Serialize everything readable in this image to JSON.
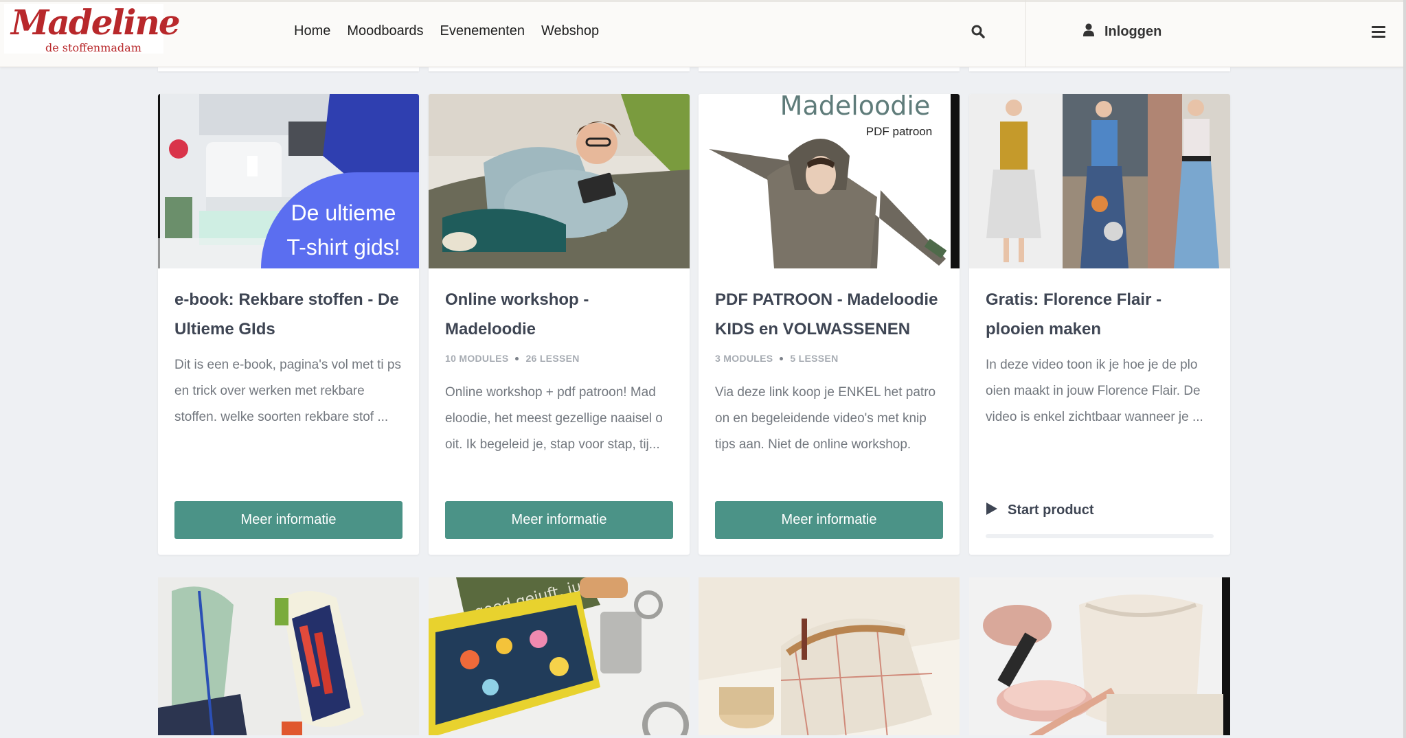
{
  "logo": {
    "main": "Madeline",
    "sub": "de stoffenmadam"
  },
  "nav": {
    "items": [
      "Home",
      "Moodboards",
      "Evenementen",
      "Webshop"
    ]
  },
  "header": {
    "login_label": "Inloggen"
  },
  "icons": {
    "search": "search-icon",
    "user": "user-icon",
    "menu": "hamburger-menu-icon",
    "play": "play-icon"
  },
  "colors": {
    "accent": "#4b9387",
    "logo_red": "#b8282b",
    "title": "#3e4553",
    "text": "#72777e",
    "bubble": "#5b6ef0"
  },
  "products": [
    {
      "title": "e-book: Rekbare stoffen - De Ultieme GIds",
      "image_text": [
        "De ultieme",
        "T-shirt gids!"
      ],
      "modules": "",
      "lessons": "",
      "description": "Dit is een e-book, pagina's vol met ti ps en trick over werken met rekbare stoffen. welke soorten rekbare stof ...",
      "action": "Meer informatie"
    },
    {
      "title": "Online workshop - Madeloodie",
      "modules": "10 MODULES",
      "lessons": "26 LESSEN",
      "description": "Online workshop + pdf patroon! Mad eloodie, het meest gezellige naaisel o oit. Ik begeleid je, stap voor stap, tij...",
      "action": "Meer informatie"
    },
    {
      "title": "PDF PATROON - Madeloodie KIDS en VOLWASSENEN",
      "image_text": [
        "Madeloodie",
        "PDF patroon"
      ],
      "modules": "3 MODULES",
      "lessons": "5 LESSEN",
      "description": "Via deze link koop je ENKEL het patro on en begeleidende video's met knip tips aan. Niet de online workshop.",
      "action": "Meer informatie"
    },
    {
      "title": "Gratis: Florence Flair - plooien maken",
      "modules": "",
      "lessons": "",
      "description": "In deze video toon ik je hoe je de plo oien maakt in jouw Florence Flair. De video is enkel zichtbaar wanneer je ...",
      "action": "Start product",
      "progress": 0
    }
  ],
  "next_row_images": [
    "pencil-case-photo",
    "keychain-photo",
    "toiletry-bag-photo",
    "makeup-basket-photo"
  ],
  "next_row_image_text": "goed gejuft, juf"
}
